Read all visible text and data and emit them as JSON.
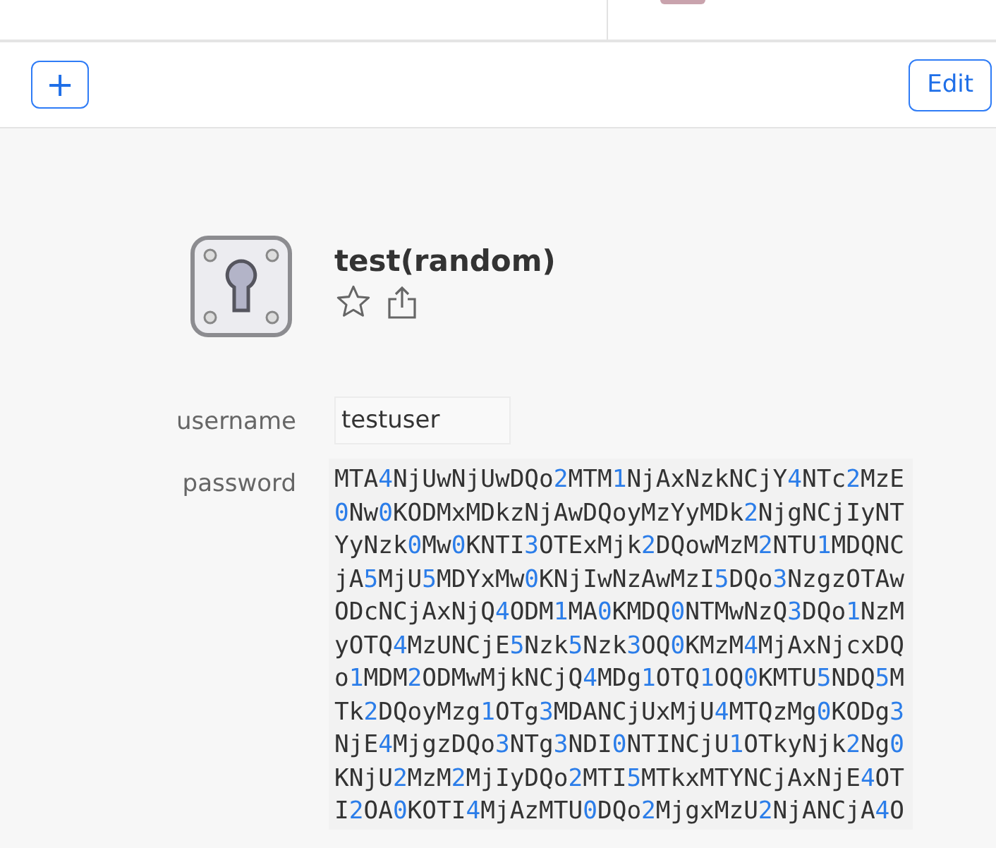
{
  "toolbar": {
    "add_button": "+",
    "edit_button": "Edit"
  },
  "item": {
    "title": "test(random)",
    "favorite": false,
    "fields": [
      {
        "kind": "text",
        "label": "username",
        "value": "testuser"
      },
      {
        "kind": "password",
        "label": "password",
        "lines": [
          "MTA4NjUwNjUwDQo2MTM1NjAxNzkNCjY4NTc2MzE",
          "0Nw0KODMxMDkzNjAwDQoyMzYyMDk2NjgNCjIyNT",
          "YyNzk0Mw0KNTI3OTExMjk2DQowMzM2NTU1MDQNC",
          "jA5MjU5MDYxMw0KNjIwNzAwMzI5DQo3NzgzOTAw",
          "ODcNCjAxNjQ4ODM1MA0KMDQ0NTMwNzQ3DQo1NzM",
          "yOTQ4MzUNCjE5Nzk5Nzk3OQ0KMzM4MjAxNjcxDQ",
          "o1MDM2ODMwMjkNCjQ4MDg1OTQ1OQ0KMTU5NDQ5M",
          "Tk2DQoyMzg1OTg3MDANCjUxMjU4MTQzMg0KODg3",
          "NjE4MjgzDQo3NTg3NDI0NTINCjU1OTkyNjk2Ng0",
          "KNjU2MzM2MjIyDQo2MTI5MTkxMTYNCjAxNjE4OT",
          "I2OA0KOTI4MjAzMTU0DQo2MjgxMzU2NjANCjA4O"
        ]
      }
    ]
  }
}
